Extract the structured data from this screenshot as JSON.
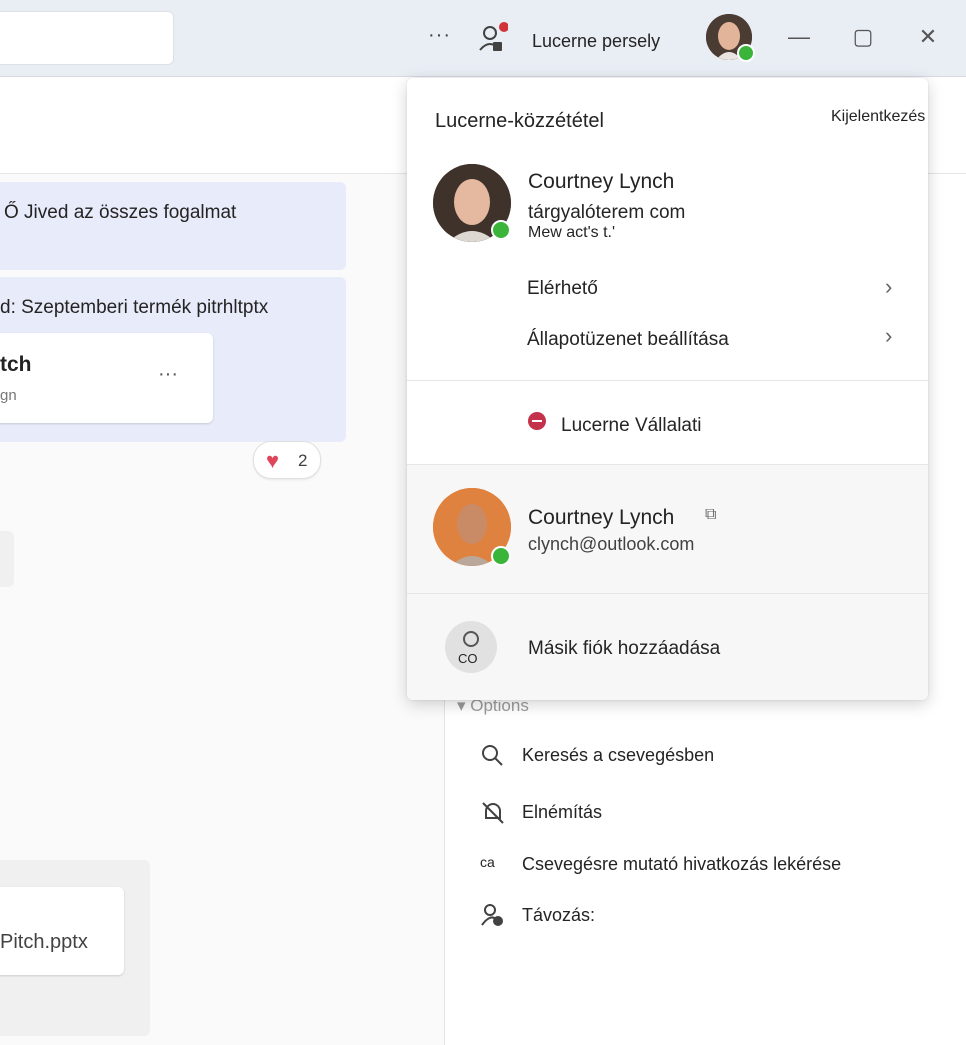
{
  "titlebar": {
    "more_label": "···",
    "user_name": "Lucerne persely",
    "minimize": "—",
    "maximize": "▢",
    "close": "✕"
  },
  "chat": {
    "message1": "Ő Jived az összes fogalmat",
    "message2": "d: Szeptemberi termék pitrhltptx",
    "card_title": "tch",
    "card_sub": "gn",
    "card_more": "···",
    "reaction_count": "2",
    "file_name": "Pitch.pptx"
  },
  "options": {
    "header": "▾ Options",
    "items": [
      {
        "icon": "search-icon",
        "label": "Keresés a csevegésben"
      },
      {
        "icon": "bell-off-icon",
        "label": "Elnémítás"
      },
      {
        "icon": "link-icon",
        "icon_text": "ca",
        "label": "Csevegésre mutató hivatkozás lekérése"
      },
      {
        "icon": "leave-icon",
        "label": "Távozás:"
      }
    ]
  },
  "flyout": {
    "org_title": "Lucerne-közzététel",
    "sign_out": "Kijelentkezés",
    "primary": {
      "name": "Courtney Lynch",
      "email": "tárgyalóterem com",
      "status_note": "Mew act's t.'"
    },
    "availability": "Elérhető",
    "status_message": "Állapotüzenet beállítása",
    "org_status": "Lucerne Vállalati",
    "secondary": {
      "name": "Courtney Lynch",
      "email": "clynch@outlook.com"
    },
    "add_account_icon_text": "CO",
    "add_account": "Másik fiók hozzáadása",
    "colors": {
      "presence": "#3ab53a",
      "dnd": "#c4314b"
    }
  }
}
